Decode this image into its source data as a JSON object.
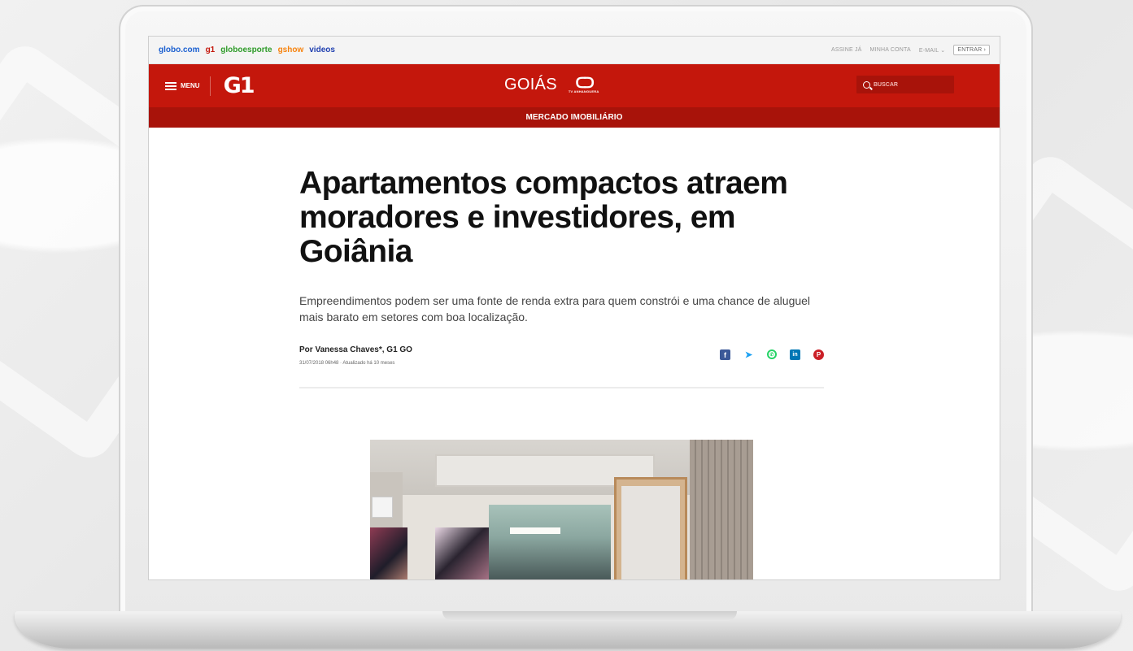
{
  "globo_bar": {
    "links": [
      "globo.com",
      "g1",
      "globoesporte",
      "gshow",
      "videos"
    ],
    "right": [
      "ASSINE JÁ",
      "MINHA CONTA",
      "E-MAIL ⌄",
      "ENTRAR ›"
    ]
  },
  "header": {
    "menu_label": "MENU",
    "logo": "G1",
    "region": "GOIÁS",
    "tv_logo_mark": "ᑕᑐ",
    "tv_logo_name": "TV ANHANGUERA",
    "search_placeholder": "BUSCAR"
  },
  "section": {
    "label": "MERCADO IMOBILIÁRIO"
  },
  "article": {
    "headline": "Apartamentos compactos atraem moradores e investidores, em Goiânia",
    "subhead": "Empreendimentos podem ser uma fonte de renda extra para quem constrói e uma chance de aluguel mais barato em setores com boa localização.",
    "author": "Por Vanessa Chaves*, G1 GO",
    "dateline": "31/07/2018 06h48 · Atualizado há 10 meses"
  },
  "share": {
    "icons": [
      "facebook-icon",
      "twitter-icon",
      "whatsapp-icon",
      "linkedin-icon",
      "pinterest-icon"
    ],
    "glyphs": {
      "facebook": "f",
      "twitter": "🐦",
      "whatsapp": "✆",
      "linkedin": "in",
      "pinterest": "P"
    }
  },
  "colors": {
    "brand_red": "#c4170c",
    "section_red": "#a8130a"
  }
}
